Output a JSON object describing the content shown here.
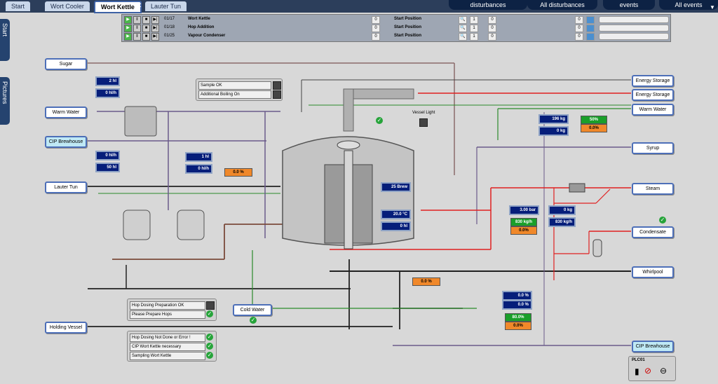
{
  "tabs": {
    "start": "Start",
    "wort_cooler": "Wort Cooler",
    "wort_kettle": "Wort Kettle",
    "lauter_tun": "Lauter Tun"
  },
  "right_tabs": {
    "disturbances": "disturbances",
    "all_disturbances": "All disturbances",
    "events": "events",
    "all_events": "All events"
  },
  "side_tabs": {
    "start": "Start",
    "pictures": "Pictures"
  },
  "sequences": [
    {
      "step": "01/17",
      "name": "Wort Kettle",
      "count": "0",
      "position": "Start Position",
      "a": "1",
      "b": "0",
      "c": "0"
    },
    {
      "step": "01/18",
      "name": "Hop Addition",
      "count": "0",
      "position": "Start Position",
      "a": "1",
      "b": "0",
      "c": "0"
    },
    {
      "step": "01/25",
      "name": "Vapour Condenser",
      "count": "0",
      "position": "Start Position",
      "a": "1",
      "b": "0",
      "c": "0"
    }
  ],
  "left_labels": {
    "sugar": "Sugar",
    "warm_water": "Warm Water",
    "cip_brewhouse": "CIP Brewhouse",
    "lauter_tun": "Lauter Tun",
    "holding_vessel": "Holding Vessel",
    "cold_water": "Cold Water"
  },
  "right_labels": {
    "energy_storage_1": "Energy Storage",
    "energy_storage_2": "Energy Storage",
    "warm_water": "Warm Water",
    "syrup": "Syrup",
    "steam": "Steam",
    "condensate": "Condensate",
    "whirlpool": "Whirlpool",
    "cip_brewhouse": "CIP Brewhouse"
  },
  "values": {
    "v_2hl": "2 hl",
    "v_0hlh_1": "0 hl/h",
    "v_0hlh_2": "0 hl/h",
    "v_50hl": "50 hl",
    "v_1hl": "1 hl",
    "v_0hlh_3": "0 hl/h",
    "v_196kg": "196 kg",
    "v_0kg_1": "0 kg",
    "v_25brew": "25 Brew",
    "v_temp": "20.0 °C",
    "v_0hl": "0 hl",
    "v_3bar": "3.00 bar",
    "v_0kg_2": "0 kg",
    "v_830kgh_1": "830 kg/h",
    "v_830kgh_2": "830 kg/h",
    "v_0pct_blue_1": "0.0 %",
    "v_0pct_blue_2": "0.0 %"
  },
  "green_values": {
    "g_50": "50%",
    "g_830": "830 kg/h",
    "g_0": "0.0%",
    "g_80": "80.0%"
  },
  "orange_values": {
    "o_1": "0.0 %",
    "o_2": "0.0%",
    "o_3": "0.0%",
    "o_4": "0.0 %",
    "o_5": "0.0%"
  },
  "messages_top": {
    "sample": "Sample OK",
    "boiling": "Additional Boiling On"
  },
  "messages_hop": {
    "prep": "Hop Dosing Preparation OK",
    "prepare": "Please Prepare Hops"
  },
  "messages_bottom": {
    "not_done": "Hop Dosing Not Done or Error !",
    "cip": "CIP Wort Kettle necessary",
    "sampling": "Sampling Wort Kettle"
  },
  "vessel_light": "Vessel Light",
  "plc": "PLC01",
  "colors": {
    "accent": "#3e62a5",
    "display": "#061e7a",
    "ok": "#26a43a",
    "warning": "#f0882a",
    "steam": "#e02020"
  }
}
